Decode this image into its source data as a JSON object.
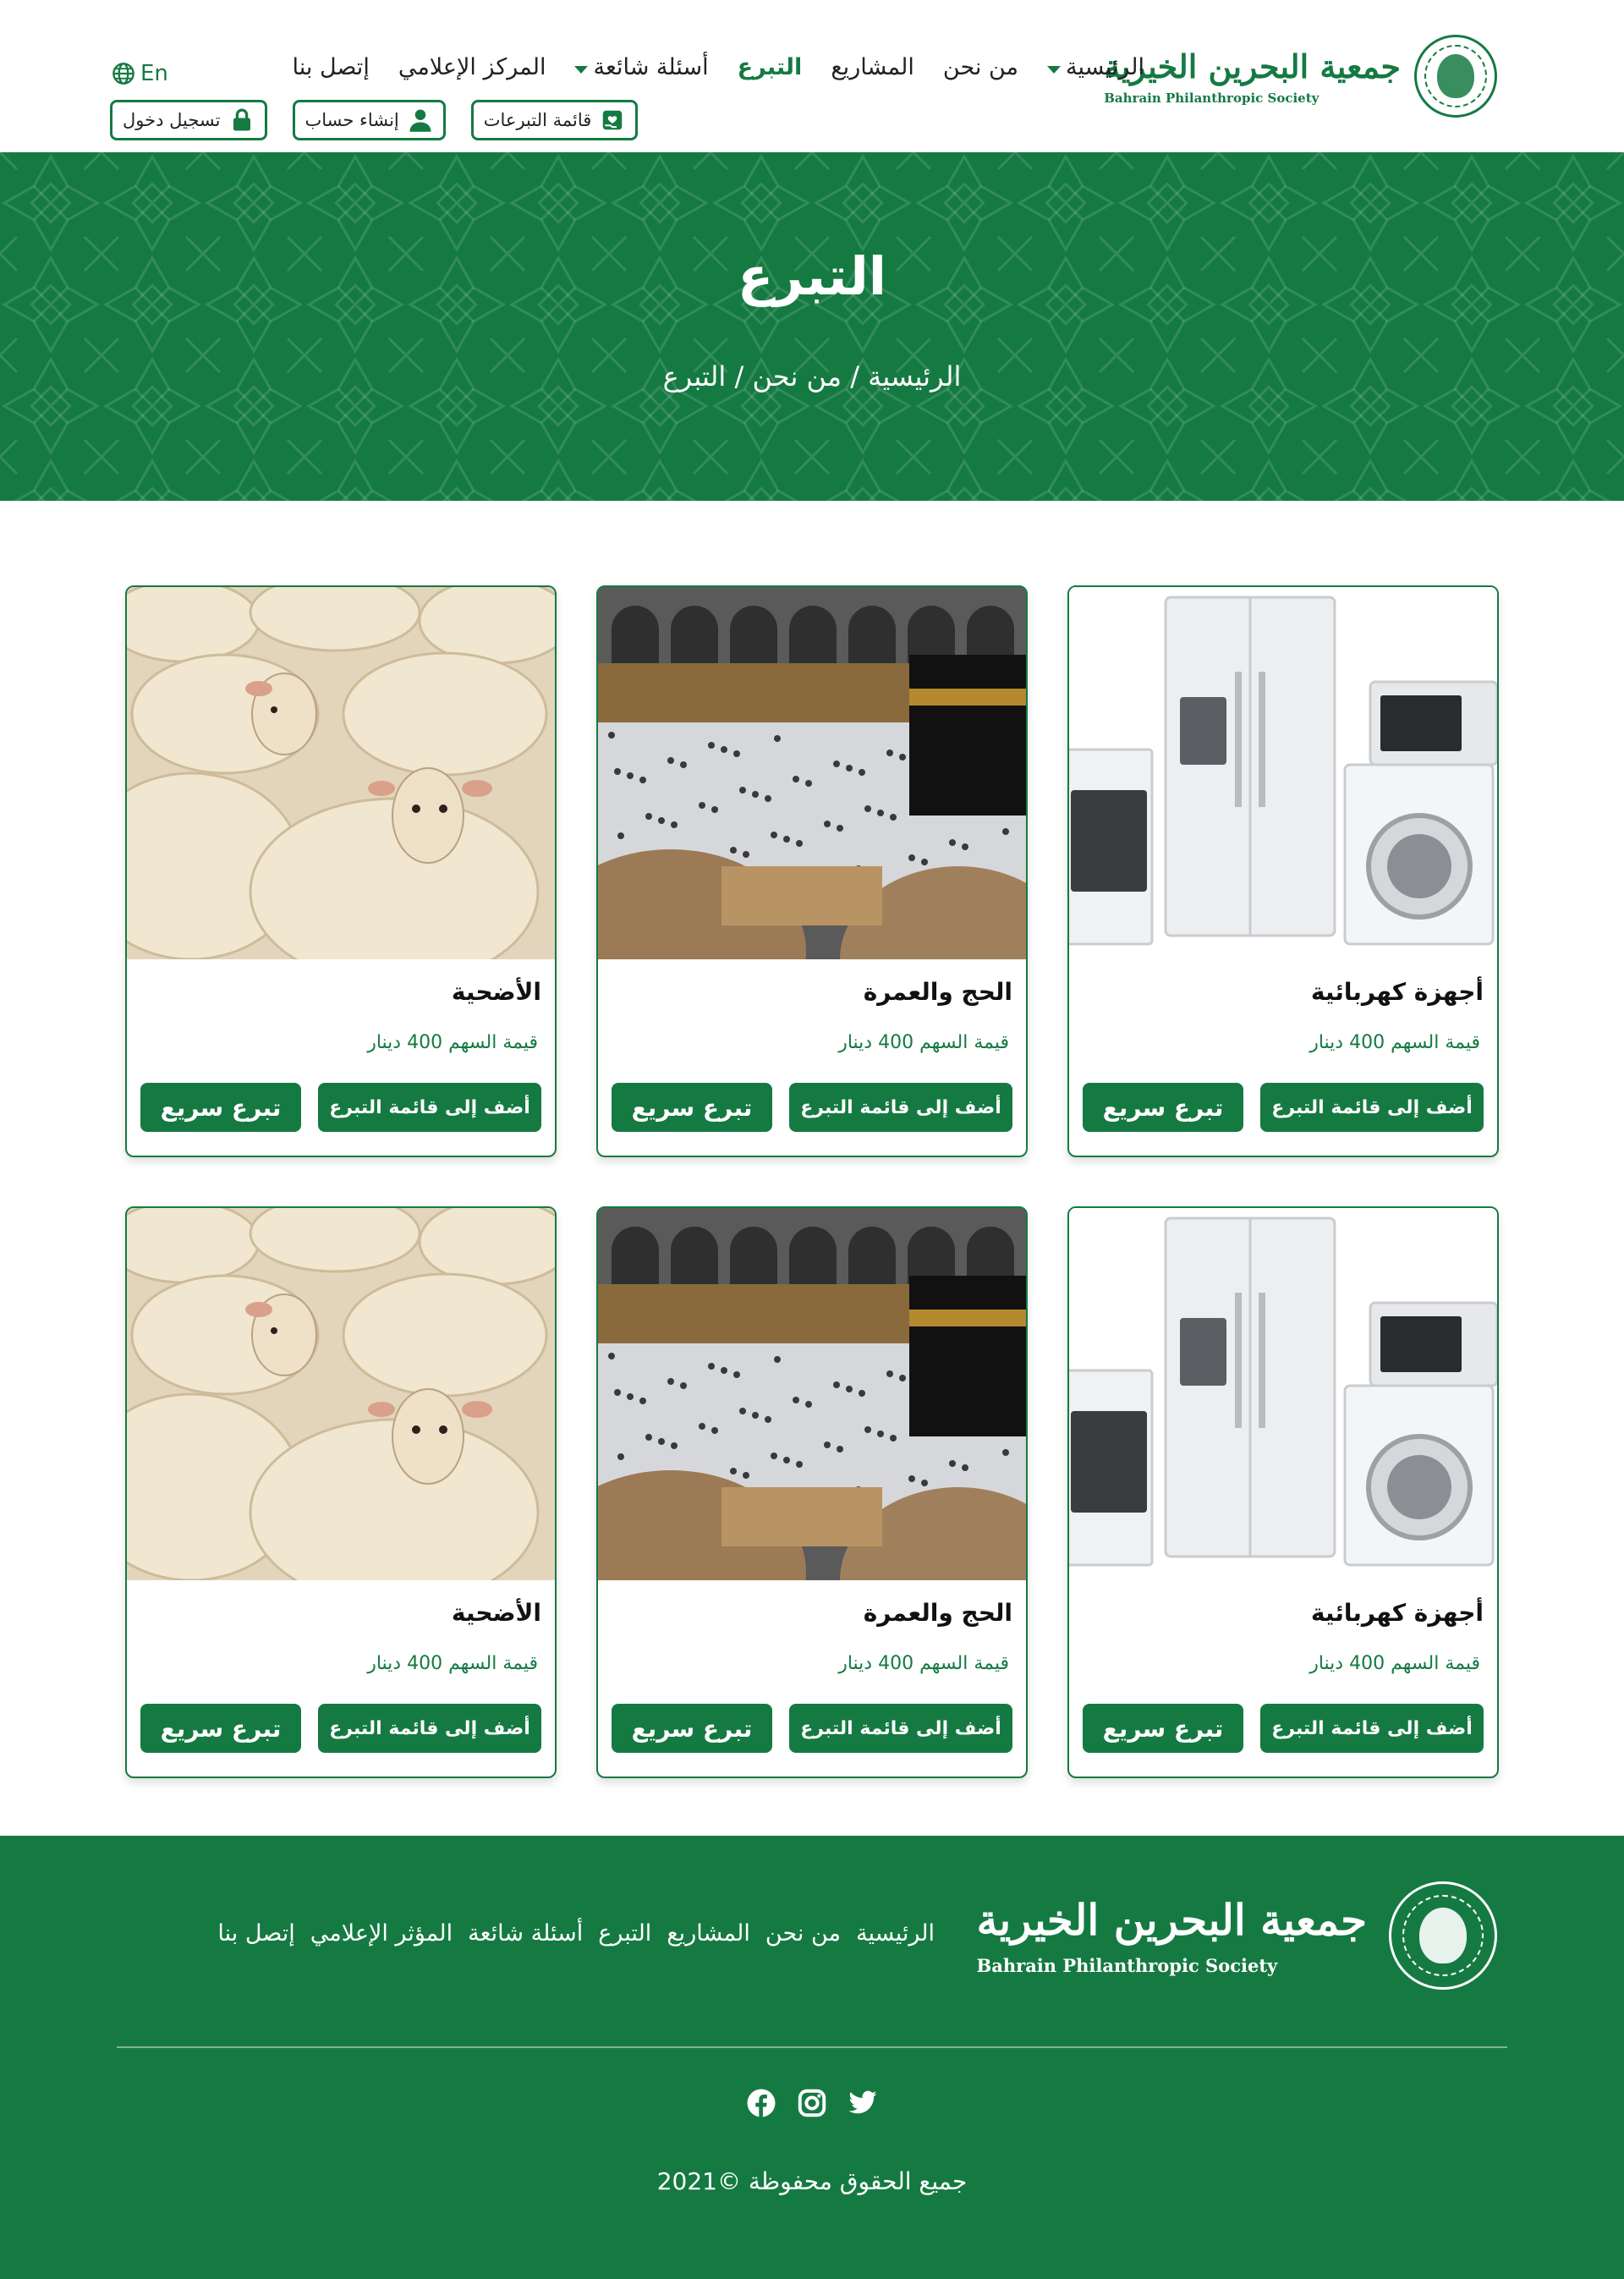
{
  "header": {
    "logo_ar": "جمعية البحرين الخيرية",
    "logo_en": "Bahrain Philanthropic Society",
    "nav": [
      {
        "label": "الرئيسية",
        "dropdown": true,
        "active": false
      },
      {
        "label": "من نحن",
        "dropdown": false,
        "active": false
      },
      {
        "label": "المشاريع",
        "dropdown": false,
        "active": false
      },
      {
        "label": "التبرع",
        "dropdown": false,
        "active": true
      },
      {
        "label": "أسئلة شائعة",
        "dropdown": true,
        "active": false
      },
      {
        "label": "المركز الإعلامي",
        "dropdown": false,
        "active": false
      },
      {
        "label": "إتصل بنا",
        "dropdown": false,
        "active": false
      }
    ],
    "language_label": "En",
    "auth": {
      "donations_list": "قائمة التبرعات",
      "create_account": "إنشاء حساب",
      "login": "تسجيل دخول"
    }
  },
  "hero": {
    "title": "التبرع",
    "breadcrumb": [
      "الرئيسية",
      "من نحن",
      "التبرع"
    ],
    "breadcrumb_separator": " / "
  },
  "cards": [
    {
      "title": "أجهزة كهربائية",
      "price": "قيمة السهم 400 دينار",
      "image": "appliances",
      "add_label": "أضف إلى قائمة التبرع",
      "quick_label": "تبرع سريع"
    },
    {
      "title": "الحج والعمرة",
      "price": "قيمة السهم 400 دينار",
      "image": "kaaba",
      "add_label": "أضف إلى قائمة التبرع",
      "quick_label": "تبرع سريع"
    },
    {
      "title": "الأضحية",
      "price": "قيمة السهم 400 دينار",
      "image": "sheep",
      "add_label": "أضف إلى قائمة التبرع",
      "quick_label": "تبرع سريع"
    },
    {
      "title": "أجهزة كهربائية",
      "price": "قيمة السهم 400 دينار",
      "image": "appliances",
      "add_label": "أضف إلى قائمة التبرع",
      "quick_label": "تبرع سريع"
    },
    {
      "title": "الحج والعمرة",
      "price": "قيمة السهم 400 دينار",
      "image": "kaaba",
      "add_label": "أضف إلى قائمة التبرع",
      "quick_label": "تبرع سريع"
    },
    {
      "title": "الأضحية",
      "price": "قيمة السهم 400 دينار",
      "image": "sheep",
      "add_label": "أضف إلى قائمة التبرع",
      "quick_label": "تبرع سريع"
    }
  ],
  "footer": {
    "logo_ar": "جمعية البحرين الخيرية",
    "logo_en": "Bahrain Philanthropic Society",
    "nav": [
      "الرئيسية",
      "من نحن",
      "المشاريع",
      "التبرع",
      "أسئلة شائعة",
      "المؤثر الإعلامي",
      "إتصل بنا"
    ],
    "socials": [
      "twitter-icon",
      "instagram-icon",
      "facebook-icon"
    ],
    "copyright": "جميع الحقوق محفوظة ©2021"
  },
  "colors": {
    "brand_green": "#157a42",
    "white": "#ffffff",
    "text_dark": "#222222"
  }
}
